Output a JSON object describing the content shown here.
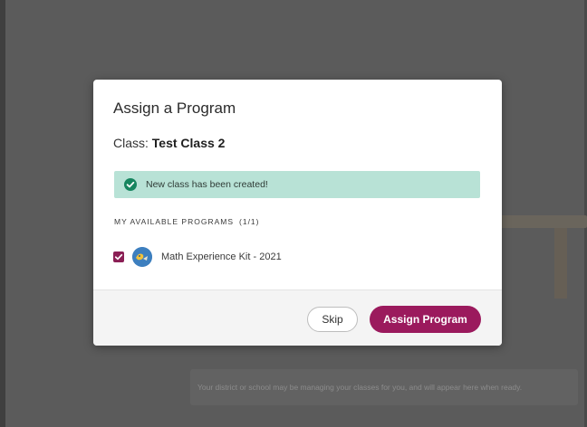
{
  "background": {
    "notice_text": "Your district or school may be managing your classes for you, and will appear here when ready."
  },
  "modal": {
    "title": "Assign a Program",
    "class_label": "Class:",
    "class_name": "Test Class 2",
    "alert": {
      "icon": "check-circle-icon",
      "text": "New class has been created!",
      "color": "#b8e2d6"
    },
    "section": {
      "heading": "MY AVAILABLE PROGRAMS",
      "count": "(1/1)"
    },
    "programs": [
      {
        "name": "Math Experience Kit - 2021",
        "checked": true,
        "icon": "program-logo-icon"
      }
    ],
    "footer": {
      "skip_label": "Skip",
      "assign_label": "Assign Program"
    }
  },
  "colors": {
    "accent": "#9b1a5d",
    "success": "#16855f",
    "overlay": "#5b5b5b"
  }
}
